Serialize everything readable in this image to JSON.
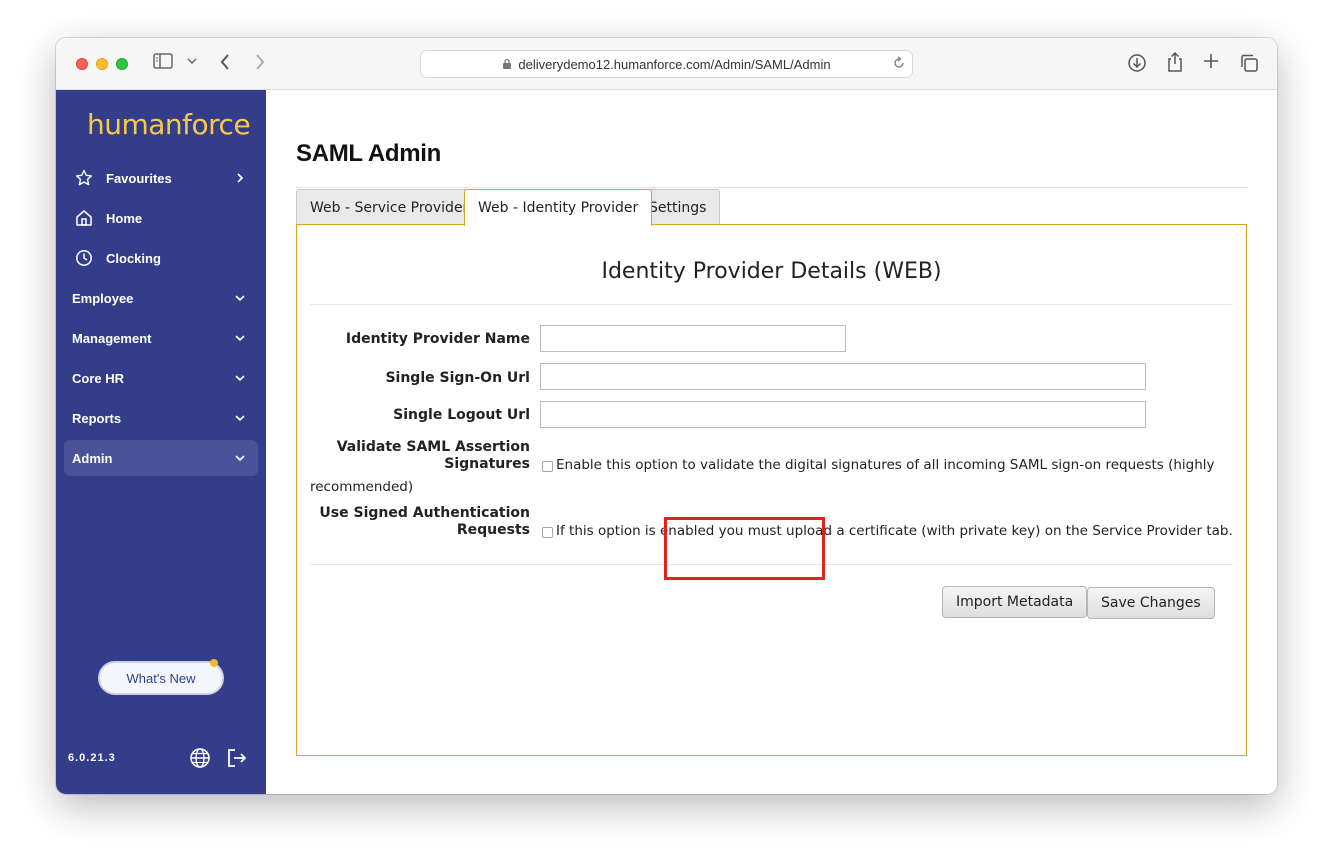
{
  "browser": {
    "url": "deliverydemo12.humanforce.com/Admin/SAML/Admin",
    "icons": [
      "sidebar-toggle-icon",
      "chevron-down-icon",
      "back-icon",
      "forward-icon",
      "lock-icon",
      "reload-icon",
      "download-icon",
      "share-icon",
      "new-tab-icon",
      "tabs-overview-icon"
    ]
  },
  "sidebar": {
    "logo": "humanforce",
    "items": [
      {
        "label": "Favourites",
        "icon": "star-icon"
      },
      {
        "label": "Home",
        "icon": "home-icon"
      },
      {
        "label": "Clocking",
        "icon": "clock-icon"
      },
      {
        "label": "Employee"
      },
      {
        "label": "Management"
      },
      {
        "label": "Core HR"
      },
      {
        "label": "Reports"
      },
      {
        "label": "Admin"
      }
    ],
    "whats_new": "What's New",
    "version": "6.0.21.3"
  },
  "page": {
    "title": "SAML Admin",
    "tabs": [
      {
        "label": "Web - Service Provider"
      },
      {
        "label": "Web - Identity Provider"
      },
      {
        "label": "Settings"
      }
    ],
    "active_tab": "Web - Identity Provider",
    "panel_heading": "Identity Provider Details (WEB)",
    "form": {
      "idp_name_label": "Identity Provider Name",
      "idp_name_value": "",
      "sso_url_label": "Single Sign-On Url",
      "sso_url_value": "",
      "logout_url_label": "Single Logout Url",
      "logout_url_value": "",
      "validate_label_line1": "Validate SAML Assertion",
      "validate_label_line2": "Signatures",
      "validate_help_line1": "Enable this option to validate the digital signatures of all incoming SAML sign-on requests (highly",
      "validate_help_line2": "recommended)",
      "signed_label_line1": "Use Signed Authentication",
      "signed_label_line2": "Requests",
      "signed_help": "If this option is enabled you must upload a certificate (with private key) on the Service Provider tab."
    },
    "buttons": {
      "import": "Import Metadata",
      "save": "Save Changes"
    }
  },
  "colors": {
    "sidebar_bg": "#343d8a",
    "logo": "#f7c948",
    "panel_border": "#d9a521",
    "highlight": "#e0231b"
  }
}
